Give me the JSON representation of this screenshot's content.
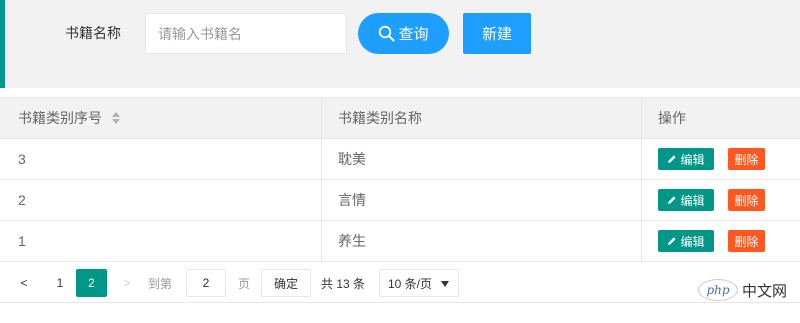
{
  "search": {
    "label": "书籍名称",
    "placeholder": "请输入书籍名",
    "query_label": "查询",
    "new_label": "新建"
  },
  "table": {
    "headers": [
      "书籍类别序号",
      "书籍类别名称",
      "操作"
    ],
    "rows": [
      {
        "id": "3",
        "name": "耽美"
      },
      {
        "id": "2",
        "name": "言情"
      },
      {
        "id": "1",
        "name": "养生"
      }
    ],
    "edit_label": "编辑",
    "delete_label": "删除"
  },
  "pager": {
    "prev": "<",
    "pages": [
      "1",
      "2"
    ],
    "current_page": "2",
    "next": ">",
    "goto_label": "到第",
    "goto_value": "2",
    "page_unit": "页",
    "confirm_label": "确定",
    "total_label": "共 13 条",
    "limit_value": "10 条/页"
  },
  "watermark": {
    "logo": "php",
    "text": "中文网"
  },
  "colors": {
    "accent_teal": "#009688",
    "primary_blue": "#1E9FFF",
    "danger_orange": "#FF5722"
  }
}
